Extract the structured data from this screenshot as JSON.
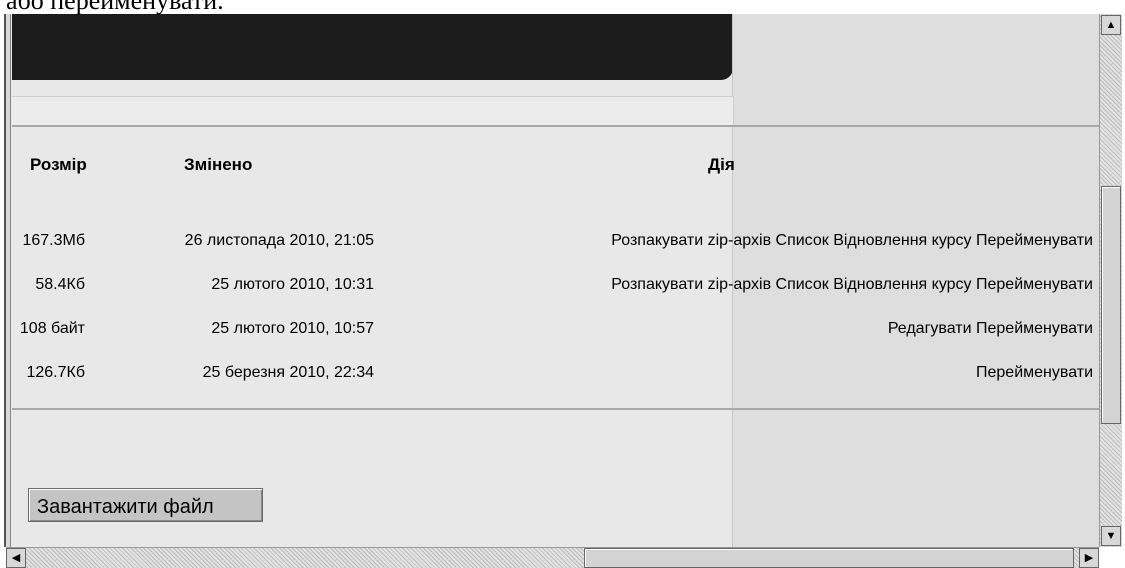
{
  "caption": "або перейменувати.",
  "table": {
    "headers": {
      "size": "Розмір",
      "modified": "Змінено",
      "action": "Дія"
    },
    "rows": [
      {
        "size": "167.3Мб",
        "modified": "26 листопада 2010, 21:05",
        "actions": "Розпакувати zip-архів Список Відновлення курсу Перейменувати"
      },
      {
        "size": "58.4Кб",
        "modified": "25 лютого 2010, 10:31",
        "actions": "Розпакувати zip-архів Список Відновлення курсу Перейменувати"
      },
      {
        "size": "108 байт",
        "modified": "25 лютого 2010, 10:57",
        "actions": "Редагувати Перейменувати"
      },
      {
        "size": "126.7Кб",
        "modified": "25 березня 2010, 22:34",
        "actions": "Перейменувати"
      }
    ]
  },
  "upload_button": "Завантажити файл",
  "icons": {
    "scroll_up": "arrow-up-icon",
    "scroll_down": "arrow-down-icon",
    "scroll_left": "arrow-left-icon",
    "scroll_right": "arrow-right-icon"
  }
}
